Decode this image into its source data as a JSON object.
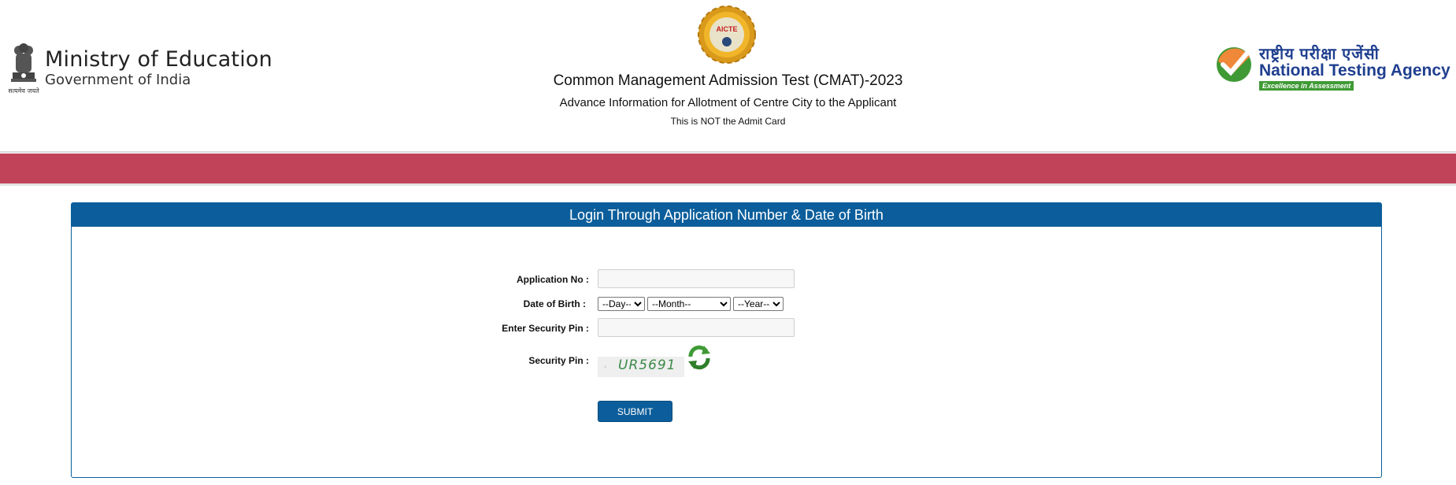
{
  "header": {
    "left_logo": {
      "title": "Ministry of Education",
      "subtitle": "Government of India",
      "emblem_motto": "सत्यमेव जयते",
      "icon": "national-emblem-icon"
    },
    "center": {
      "logo_text": "AICTE",
      "title": "Common Management Admission Test (CMAT)-2023",
      "subtitle": "Advance Information for Allotment of Centre City to the Applicant",
      "note": "This is NOT the Admit Card"
    },
    "right_logo": {
      "hindi": "राष्ट्रीय परीक्षा एजेंसी",
      "title": "National Testing Agency",
      "tagline": "Excellence in Assessment",
      "icon": "nta-check-icon"
    }
  },
  "colors": {
    "band": "#c1435a",
    "primary": "#0b5e9b",
    "captcha_text": "#3c8a4a",
    "nta_green": "#3f9a35",
    "nta_orange": "#f0883a"
  },
  "login": {
    "heading": "Login Through Application Number & Date of Birth",
    "application_no_label": "Application No :",
    "application_no_value": "",
    "dob_label": "Date of Birth :",
    "day_selected": "--Day--",
    "month_selected": "--Month--",
    "year_selected": "--Year--",
    "security_pin_input_label": "Enter Security Pin :",
    "security_pin_input_value": "",
    "security_pin_label": "Security Pin :",
    "captcha_text": "UR5691",
    "refresh_icon": "refresh-icon",
    "submit_label": "SUBMIT"
  }
}
